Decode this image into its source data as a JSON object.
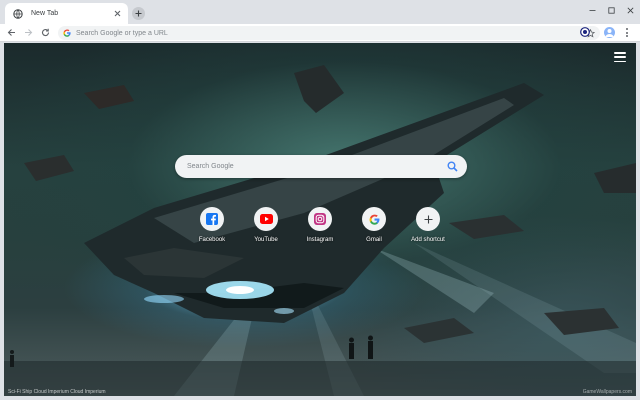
{
  "tabs": [
    {
      "title": "New Tab"
    }
  ],
  "toolbar": {
    "omnibox_placeholder": "Search Google or type a URL"
  },
  "newtab": {
    "search_placeholder": "Search Google",
    "shortcuts": [
      {
        "label": "Facebook",
        "icon": "facebook-icon"
      },
      {
        "label": "YouTube",
        "icon": "youtube-icon"
      },
      {
        "label": "Instagram",
        "icon": "instagram-icon"
      },
      {
        "label": "Gmail",
        "icon": "google-icon"
      },
      {
        "label": "Add shortcut",
        "icon": "plus-icon"
      }
    ],
    "credits": {
      "part1": "Sci-Fi Ship ",
      "part2": "Cloud Imperium ",
      "part3": "Cloud Imperium"
    },
    "watermark": "GameWallpapers.com"
  },
  "colors": {
    "tabstrip": "#dee1e6",
    "facebook": "#1877f2",
    "youtube": "#ff0000",
    "instagram": "#c13584",
    "google_blue": "#4285f4"
  }
}
